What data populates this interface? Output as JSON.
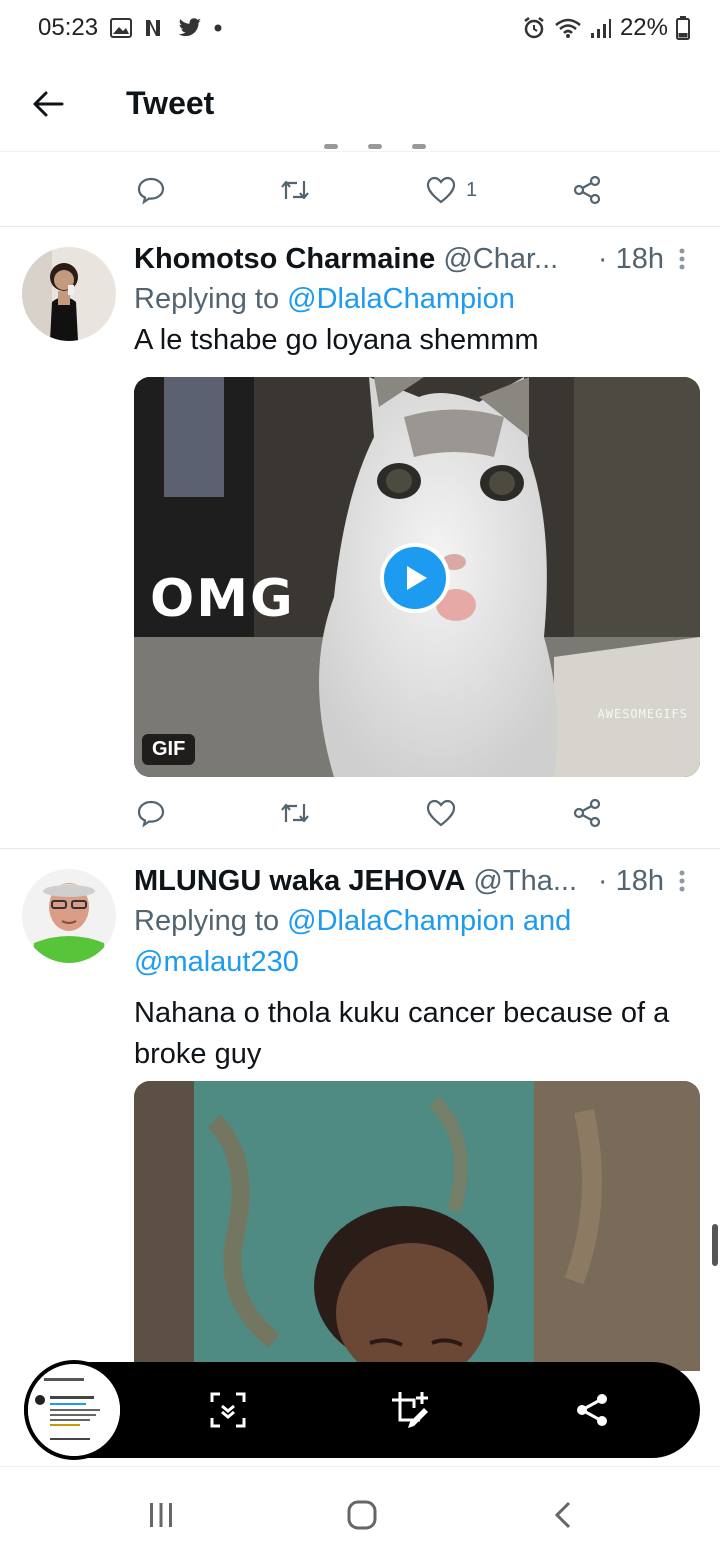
{
  "status_bar": {
    "time": "05:23",
    "notification_icons": [
      "gallery-icon",
      "netflix-icon",
      "twitter-icon",
      "dot-icon"
    ],
    "battery": "22%",
    "system_icons": [
      "alarm-icon",
      "wifi-icon",
      "signal-icon",
      "battery-icon"
    ]
  },
  "header": {
    "title": "Tweet"
  },
  "top_actions": {
    "like_count": "1"
  },
  "tweets": [
    {
      "name": "Khomotso Charmaine",
      "handle": "@Char...",
      "time": "· 18h",
      "replying_prefix": "Replying to ",
      "replying_to": "@DlalaChampion",
      "replying_to_2": "",
      "text": "A le tshabe go loyana shemmm",
      "media": {
        "type": "gif",
        "overlay_text": "OMG",
        "badge": "GIF",
        "watermark": "AWESOMEGIFS"
      }
    },
    {
      "name": "MLUNGU waka JEHOVA",
      "handle": "@Tha...",
      "time": "· 18h",
      "replying_prefix": "Replying to ",
      "replying_to": "@DlalaChampion and",
      "replying_to_2": "@malaut230",
      "text": "Nahana o thola kuku cancer because of a broke guy",
      "media": {
        "type": "image"
      }
    }
  ],
  "colors": {
    "accent": "#1d9bf0",
    "secondary_text": "#536471"
  }
}
